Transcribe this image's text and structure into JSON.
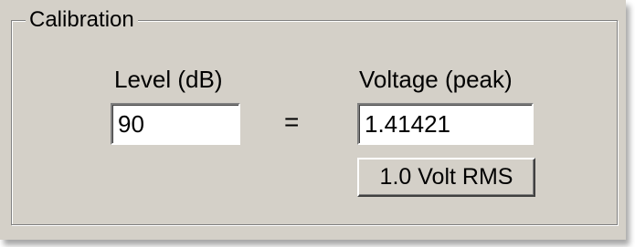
{
  "group": {
    "title": "Calibration"
  },
  "level": {
    "label": "Level (dB)",
    "value": "90"
  },
  "equals_sign": "=",
  "voltage": {
    "label": "Voltage (peak)",
    "value": "1.41421"
  },
  "rms_button": {
    "label": "1.0 Volt RMS"
  }
}
